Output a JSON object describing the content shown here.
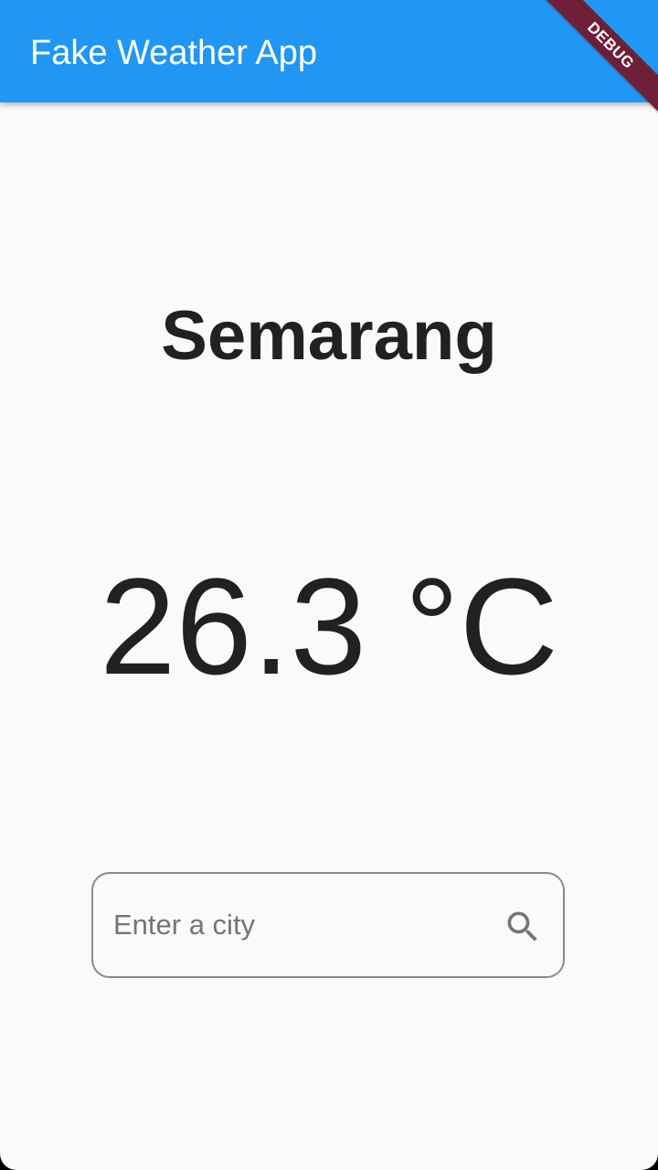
{
  "app_bar": {
    "title": "Fake Weather App",
    "color": "#2196f3"
  },
  "debug_banner": {
    "label": "DEBUG",
    "color": "#6e1f35"
  },
  "weather": {
    "city": "Semarang",
    "temperature": "26.3 °C"
  },
  "search": {
    "value": "",
    "placeholder": "Enter a city",
    "icon": "search-icon"
  }
}
